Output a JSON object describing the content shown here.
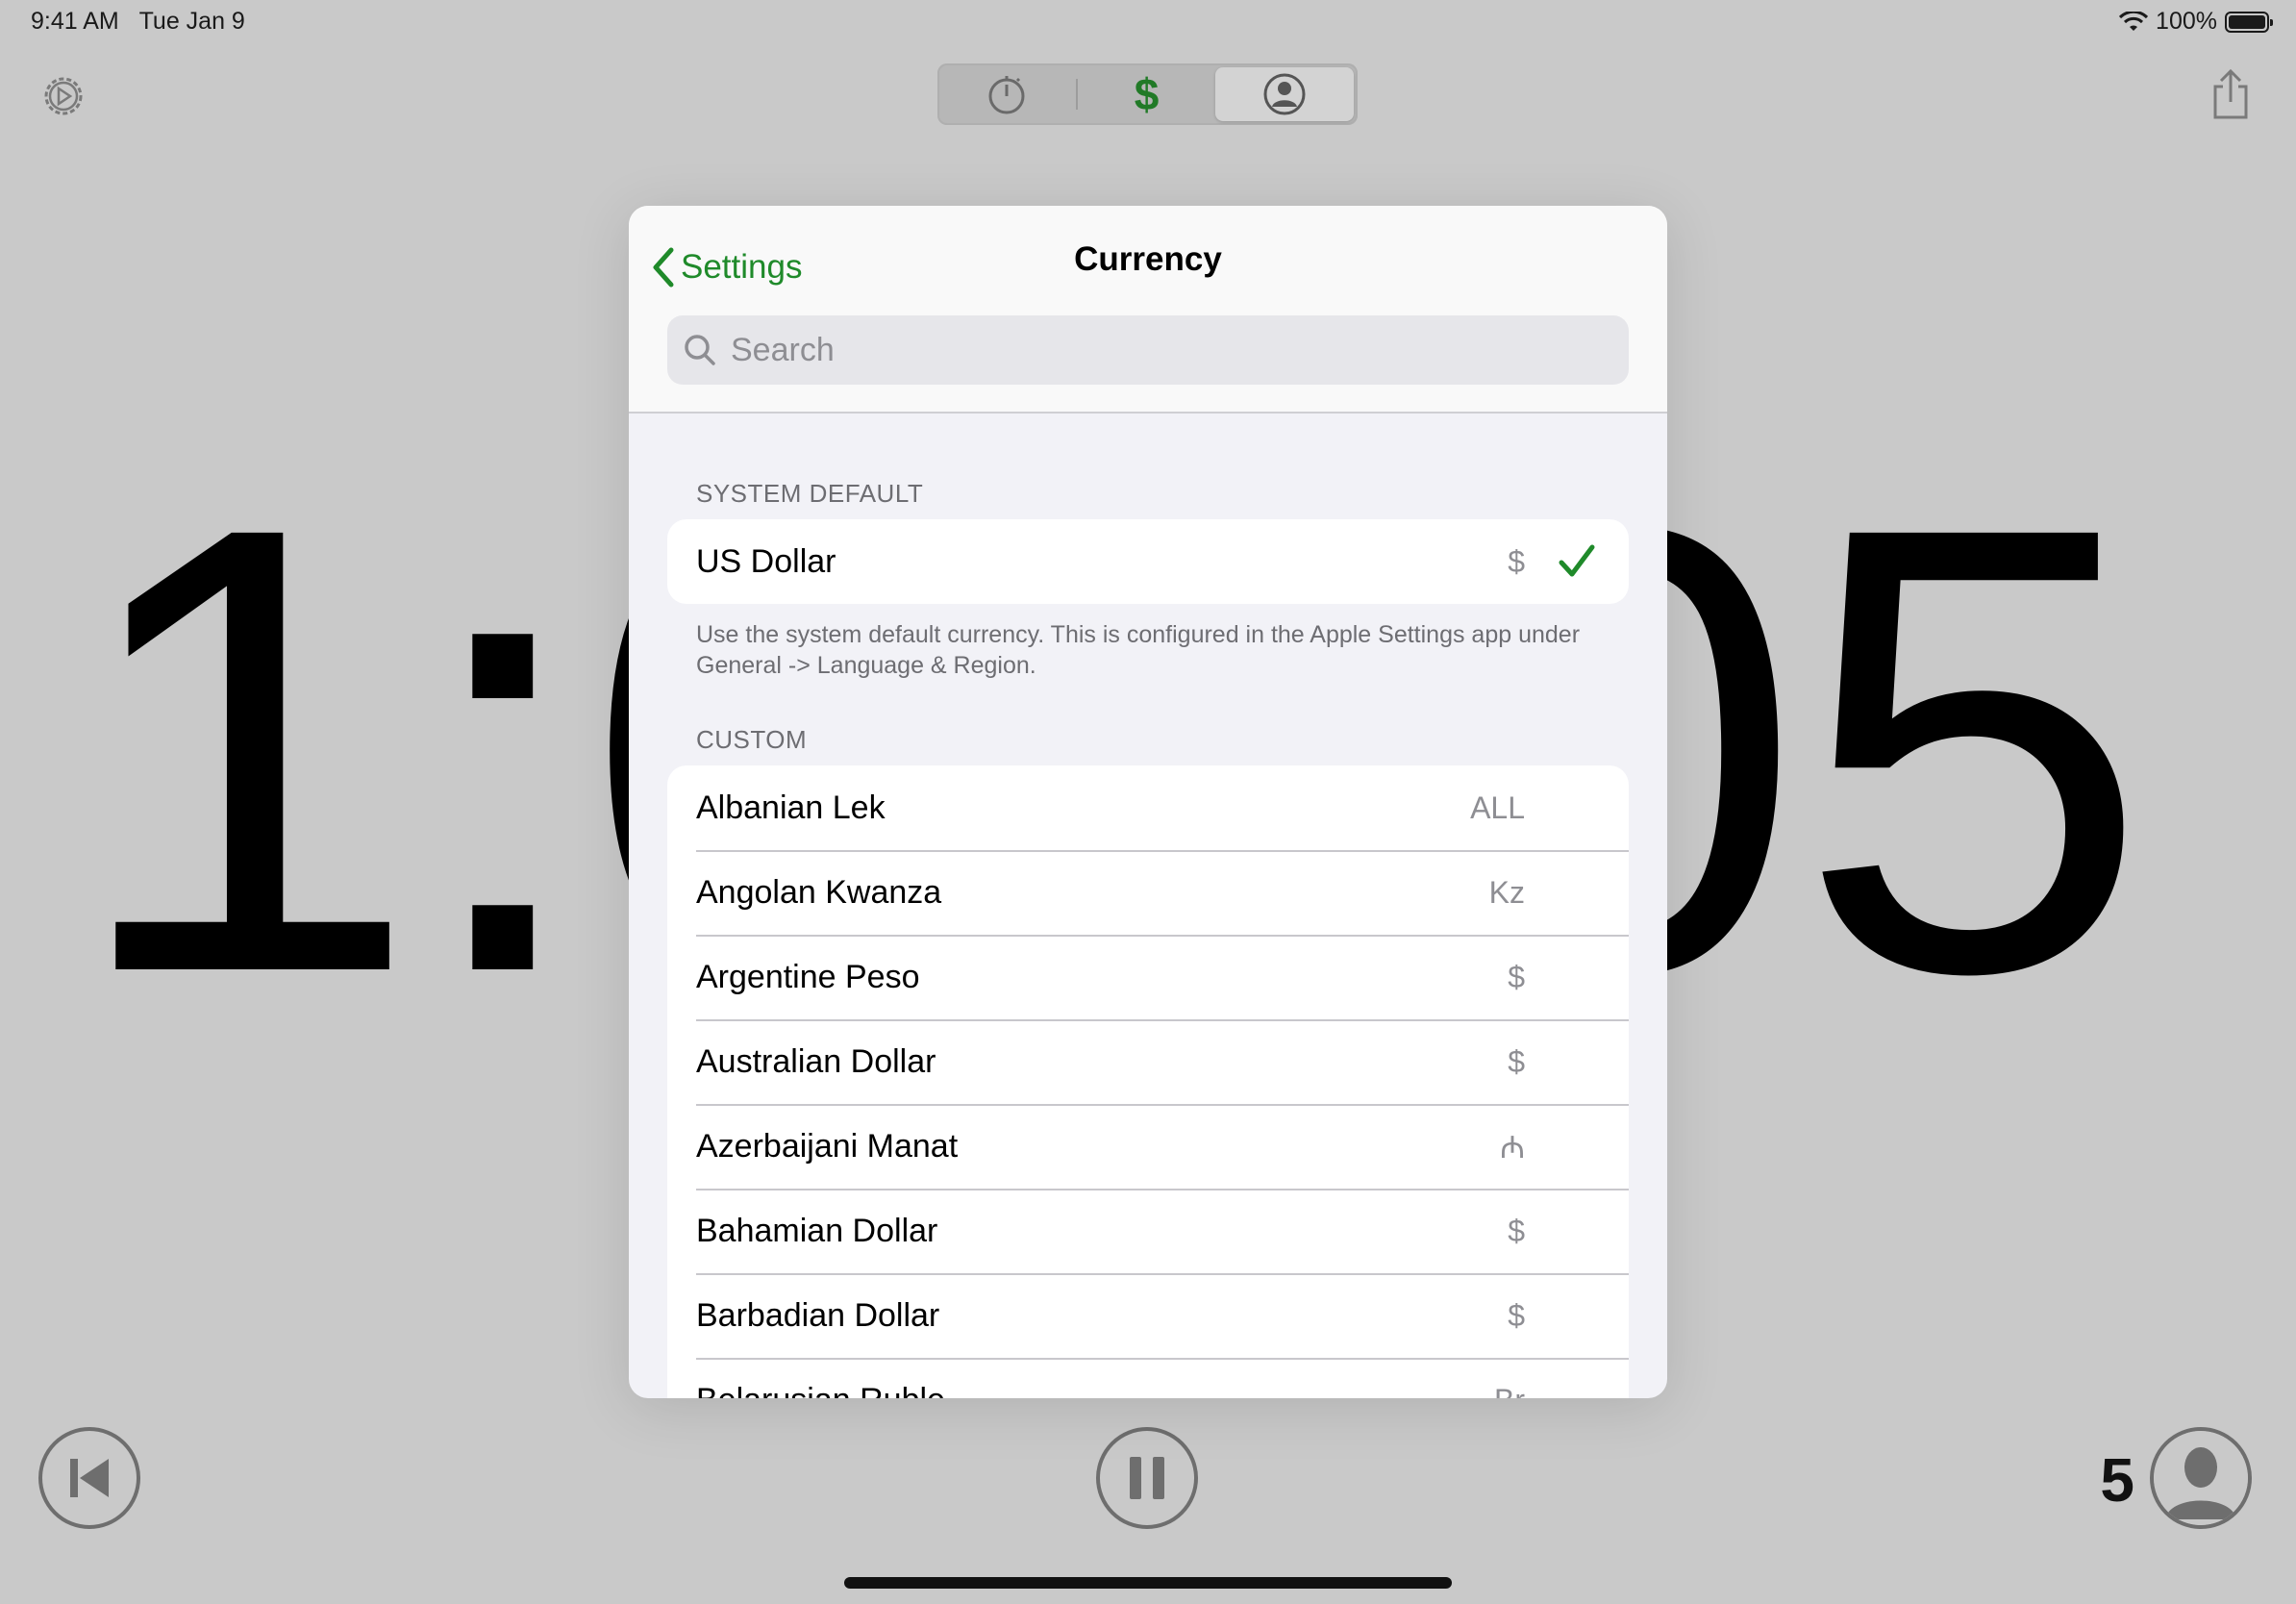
{
  "status_bar": {
    "time": "9:41 AM",
    "date": "Tue Jan 9",
    "battery": "100%"
  },
  "toolbar": {
    "settings_icon": "gear-icon",
    "share_icon": "share-icon",
    "segments": [
      {
        "icon": "stopwatch-icon"
      },
      {
        "label": "$",
        "icon": "dollar-icon"
      },
      {
        "icon": "person-icon",
        "selected": true
      }
    ]
  },
  "timer": {
    "display": "1:05:05"
  },
  "player_count": "5",
  "modal": {
    "back_label": "Settings",
    "title": "Currency",
    "search_placeholder": "Search",
    "system_default": {
      "header": "SYSTEM DEFAULT",
      "name": "US Dollar",
      "symbol": "$",
      "selected": true,
      "footer": "Use the system default currency. This is configured in the Apple Settings app under General -> Language & Region."
    },
    "custom": {
      "header": "CUSTOM",
      "items": [
        {
          "name": "Albanian Lek",
          "symbol": "ALL"
        },
        {
          "name": "Angolan Kwanza",
          "symbol": "Kz"
        },
        {
          "name": "Argentine Peso",
          "symbol": "$"
        },
        {
          "name": "Australian Dollar",
          "symbol": "$"
        },
        {
          "name": "Azerbaijani Manat",
          "symbol": "₼"
        },
        {
          "name": "Bahamian Dollar",
          "symbol": "$"
        },
        {
          "name": "Barbadian Dollar",
          "symbol": "$"
        },
        {
          "name": "Belarusian Ruble",
          "symbol": "Br"
        }
      ]
    }
  },
  "colors": {
    "accent": "#1f8a2a",
    "background": "#c9c9c9",
    "sheet": "#f2f2f7"
  }
}
